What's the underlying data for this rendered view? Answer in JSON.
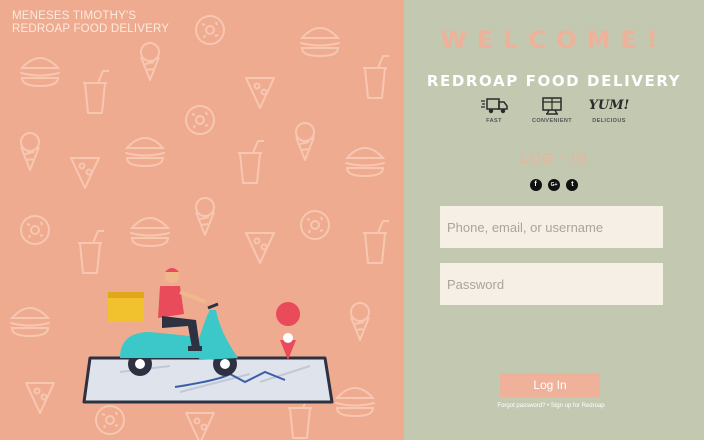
{
  "brand": {
    "line1": "MENESES TIMOTHY'S",
    "line2": "REDROAP FOOD DELIVERY"
  },
  "welcome": "WELCOME!",
  "company_name": "REDROAP  FOOD  DELIVERY",
  "features": [
    {
      "label": "FAST",
      "icon": "delivery-truck-icon"
    },
    {
      "label": "CONVENIENT",
      "icon": "delivery-box-icon"
    },
    {
      "label": "DELICIOUS",
      "icon": "yum-icon",
      "text": "YUM!"
    }
  ],
  "login": {
    "title": "LOG - IN",
    "socials": [
      {
        "name": "facebook",
        "glyph": "f"
      },
      {
        "name": "google-plus",
        "glyph": "G+"
      },
      {
        "name": "twitter",
        "glyph": "t"
      }
    ],
    "username_placeholder": "Phone, email, or username",
    "password_placeholder": "Password",
    "button_label": "Log In",
    "forgot_link": "Forgot password?",
    "separator": "•",
    "signup_link": "Sign up for Redroap"
  },
  "colors": {
    "left_bg": "#efab90",
    "right_bg": "#c3c9b0",
    "accent": "#efb19a",
    "field_bg": "#f6efe5"
  }
}
